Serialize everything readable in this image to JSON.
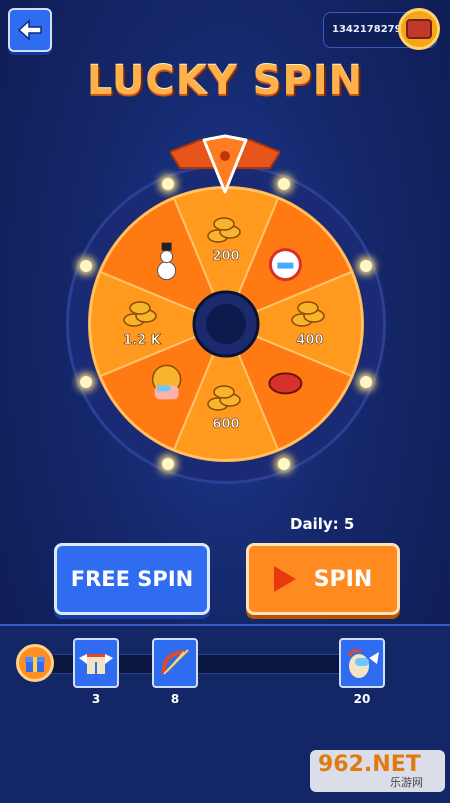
{
  "header": {
    "coins": "1342178279",
    "back_icon": "arrow-left-icon",
    "coin_icon": "treasure-chest-icon"
  },
  "title": "LUCKY SPIN",
  "wheel": {
    "segments": [
      {
        "label": "200",
        "icon": "coin-stack-icon"
      },
      {
        "label": "",
        "icon": "lion-dance-skin-icon"
      },
      {
        "label": "400",
        "icon": "coin-stack-icon"
      },
      {
        "label": "",
        "icon": "red-hat-icon"
      },
      {
        "label": "600",
        "icon": "coin-stack-icon"
      },
      {
        "label": "",
        "icon": "crewmate-hair-skin-icon"
      },
      {
        "label": "1.2 K",
        "icon": "coin-stack-icon"
      },
      {
        "label": "",
        "icon": "snowman-icon"
      }
    ],
    "colors": {
      "light": "#ff9a1f",
      "dark": "#ff7a12",
      "center": "#0d1a4d"
    }
  },
  "daily": "Daily: 5",
  "buttons": {
    "free_spin": "FREE SPIN",
    "spin": "SPIN"
  },
  "progress": {
    "milestones": [
      {
        "value": "3",
        "icon": "winged-pants-icon"
      },
      {
        "value": "8",
        "icon": "bow-arrow-icon"
      },
      {
        "value": "20",
        "icon": "cupid-crewmate-icon"
      }
    ],
    "start_icon": "gift-box-icon"
  },
  "watermark": {
    "main": "962.NET",
    "sub": "乐游网"
  }
}
